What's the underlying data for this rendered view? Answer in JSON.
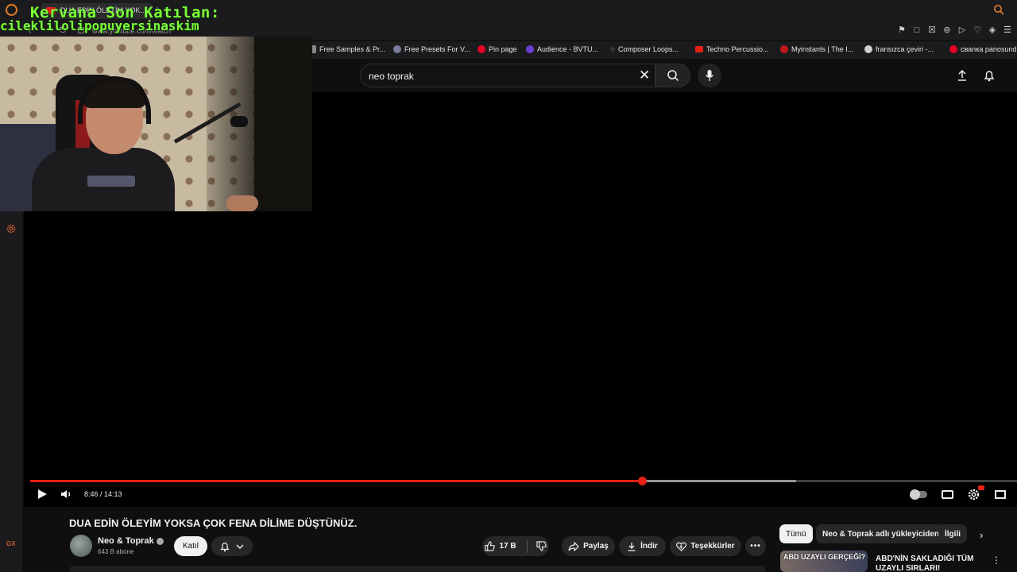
{
  "browser": {
    "active_tab_title": "DUA EDİN ÖLEYİM YOK...",
    "url": "www.youtube.com/watch",
    "bookmarks": [
      {
        "label": "Free Samples & Pr...",
        "color": "#8a8a8a"
      },
      {
        "label": "Free Presets For V...",
        "color": "#7a7a9a"
      },
      {
        "label": "Pin page",
        "color": "#e60023"
      },
      {
        "label": "Audience - BVTU...",
        "color": "#6b3fd6"
      },
      {
        "label": "Composer Loops...",
        "color": "#333333"
      },
      {
        "label": "Techno Percussio...",
        "color": "#e62117"
      },
      {
        "label": "Myinstants | The I...",
        "color": "#c4161c"
      },
      {
        "label": "fransızca çeviri -...",
        "color": "#cfcfcf"
      },
      {
        "label": "сваnка panosundi...",
        "color": "#e60023"
      }
    ]
  },
  "youtube": {
    "search_query": "neo toprak",
    "video": {
      "time": "8:46 / 14:13",
      "progress": 0.62,
      "buffered": 0.776,
      "title": "DUA EDİN ÖLEYİM YOKSA ÇOK FENA DİLİME DÜŞTÜNÜZ."
    },
    "channel": {
      "name": "Neo & Toprak",
      "subscribers": "643 B abone",
      "join_label": "Katıl"
    },
    "actions": {
      "likes": "17 B",
      "share": "Paylaş",
      "download": "İndir",
      "thanks": "Teşekkürler"
    },
    "chips": [
      "Tümü",
      "Neo & Toprak adlı yükleyiciden",
      "İlgili"
    ],
    "recommendation": {
      "thumb_text": "ABD UZAYLI GERÇEĞİ?",
      "title": "ABD'NİN SAKLADIĞI TÜM UZAYLI SIRLARI!"
    }
  },
  "stream_overlay": {
    "line1": "Kervana Son Katılan:",
    "line2": "cileklilolipopuyersinaskim"
  },
  "sidebar": {
    "gx_label": "GX"
  },
  "colors": {
    "accent_red": "#e62117",
    "overlay_green": "#7dff3c",
    "opera_orange": "#e07b2c"
  }
}
